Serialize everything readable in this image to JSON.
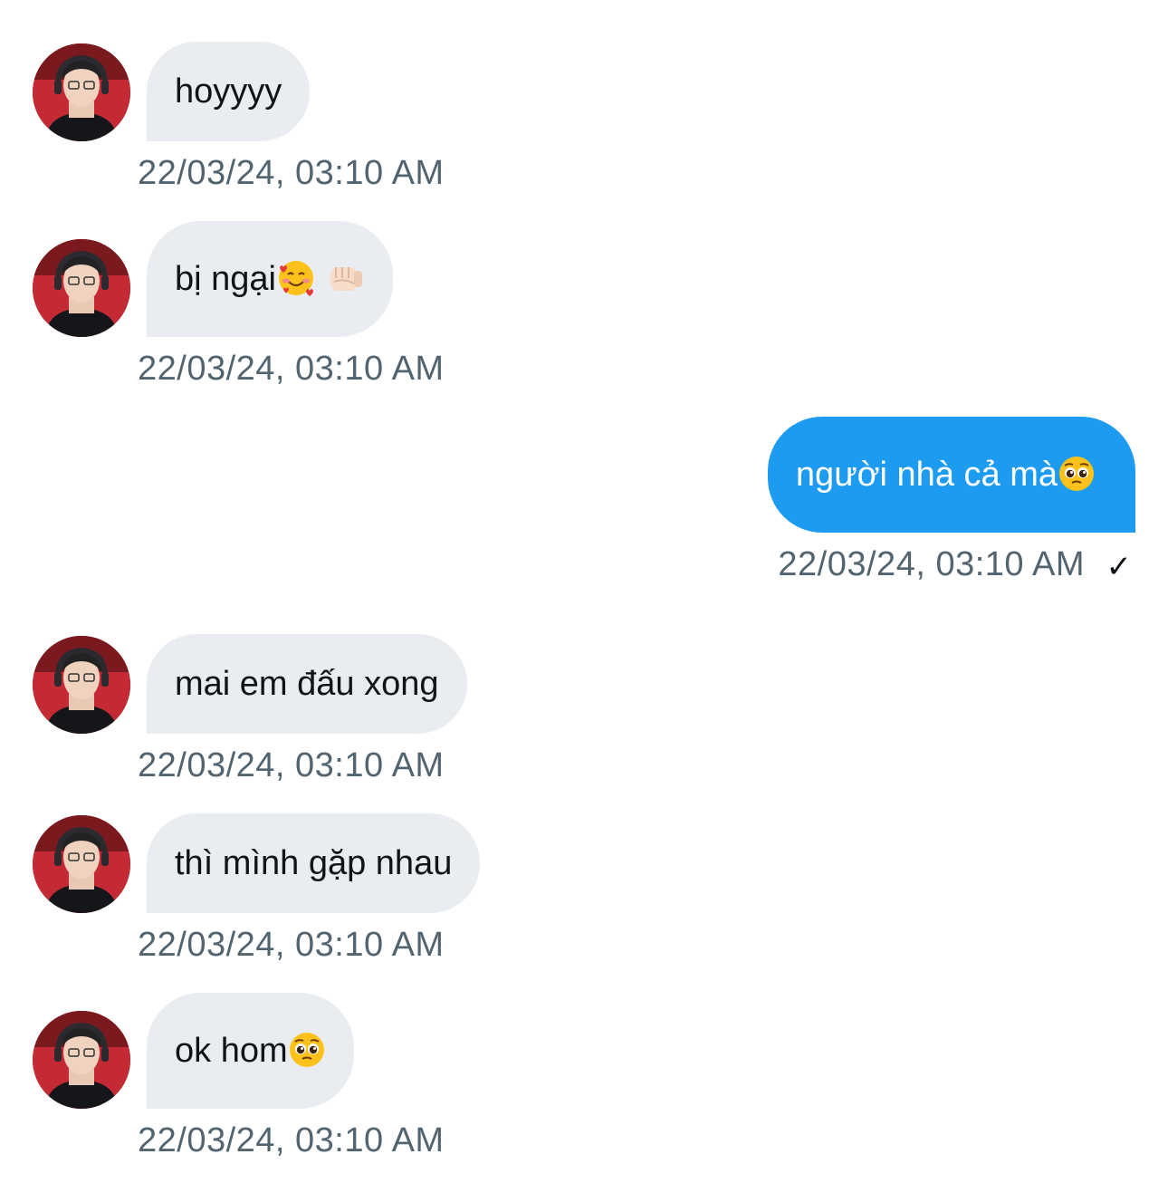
{
  "messages": [
    {
      "direction": "in",
      "text": "hoyyyy",
      "timestamp": "22/03/24, 03:10 AM"
    },
    {
      "direction": "in",
      "text": "bị ngại",
      "emojis": [
        "smiling-face-with-hearts",
        "fist-bump"
      ],
      "timestamp": "22/03/24, 03:10 AM"
    },
    {
      "direction": "out",
      "text": "người nhà cả mà",
      "emojis": [
        "pleading-face"
      ],
      "timestamp": "22/03/24, 03:10 AM",
      "status_icon": "check-icon"
    },
    {
      "direction": "in",
      "text": "mai em đấu xong",
      "timestamp": "22/03/24, 03:10 AM"
    },
    {
      "direction": "in",
      "text": "thì mình gặp nhau",
      "timestamp": "22/03/24, 03:10 AM"
    },
    {
      "direction": "in",
      "text": "ok hom",
      "emojis": [
        "pleading-face"
      ],
      "timestamp": "22/03/24, 03:10 AM"
    }
  ],
  "colors": {
    "incoming_bubble": "#e9edf1",
    "outgoing_bubble": "#1d9bf0",
    "timestamp_text": "#536471"
  }
}
